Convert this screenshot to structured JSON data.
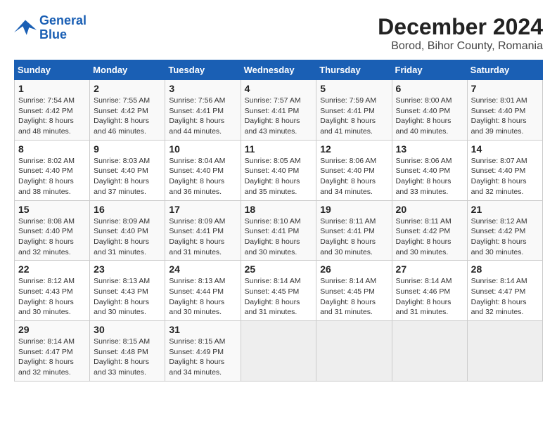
{
  "header": {
    "logo_line1": "General",
    "logo_line2": "Blue",
    "main_title": "December 2024",
    "subtitle": "Borod, Bihor County, Romania"
  },
  "calendar": {
    "days_of_week": [
      "Sunday",
      "Monday",
      "Tuesday",
      "Wednesday",
      "Thursday",
      "Friday",
      "Saturday"
    ],
    "weeks": [
      [
        {
          "day": "",
          "empty": true
        },
        {
          "day": "",
          "empty": true
        },
        {
          "day": "",
          "empty": true
        },
        {
          "day": "",
          "empty": true
        },
        {
          "day": "",
          "empty": true
        },
        {
          "day": "",
          "empty": true
        },
        {
          "day": "",
          "empty": true
        }
      ],
      [
        {
          "day": "1",
          "sunrise": "7:54 AM",
          "sunset": "4:42 PM",
          "daylight": "8 hours and 48 minutes."
        },
        {
          "day": "2",
          "sunrise": "7:55 AM",
          "sunset": "4:42 PM",
          "daylight": "8 hours and 46 minutes."
        },
        {
          "day": "3",
          "sunrise": "7:56 AM",
          "sunset": "4:41 PM",
          "daylight": "8 hours and 44 minutes."
        },
        {
          "day": "4",
          "sunrise": "7:57 AM",
          "sunset": "4:41 PM",
          "daylight": "8 hours and 43 minutes."
        },
        {
          "day": "5",
          "sunrise": "7:59 AM",
          "sunset": "4:41 PM",
          "daylight": "8 hours and 41 minutes."
        },
        {
          "day": "6",
          "sunrise": "8:00 AM",
          "sunset": "4:40 PM",
          "daylight": "8 hours and 40 minutes."
        },
        {
          "day": "7",
          "sunrise": "8:01 AM",
          "sunset": "4:40 PM",
          "daylight": "8 hours and 39 minutes."
        }
      ],
      [
        {
          "day": "8",
          "sunrise": "8:02 AM",
          "sunset": "4:40 PM",
          "daylight": "8 hours and 38 minutes."
        },
        {
          "day": "9",
          "sunrise": "8:03 AM",
          "sunset": "4:40 PM",
          "daylight": "8 hours and 37 minutes."
        },
        {
          "day": "10",
          "sunrise": "8:04 AM",
          "sunset": "4:40 PM",
          "daylight": "8 hours and 36 minutes."
        },
        {
          "day": "11",
          "sunrise": "8:05 AM",
          "sunset": "4:40 PM",
          "daylight": "8 hours and 35 minutes."
        },
        {
          "day": "12",
          "sunrise": "8:06 AM",
          "sunset": "4:40 PM",
          "daylight": "8 hours and 34 minutes."
        },
        {
          "day": "13",
          "sunrise": "8:06 AM",
          "sunset": "4:40 PM",
          "daylight": "8 hours and 33 minutes."
        },
        {
          "day": "14",
          "sunrise": "8:07 AM",
          "sunset": "4:40 PM",
          "daylight": "8 hours and 32 minutes."
        }
      ],
      [
        {
          "day": "15",
          "sunrise": "8:08 AM",
          "sunset": "4:40 PM",
          "daylight": "8 hours and 32 minutes."
        },
        {
          "day": "16",
          "sunrise": "8:09 AM",
          "sunset": "4:40 PM",
          "daylight": "8 hours and 31 minutes."
        },
        {
          "day": "17",
          "sunrise": "8:09 AM",
          "sunset": "4:41 PM",
          "daylight": "8 hours and 31 minutes."
        },
        {
          "day": "18",
          "sunrise": "8:10 AM",
          "sunset": "4:41 PM",
          "daylight": "8 hours and 30 minutes."
        },
        {
          "day": "19",
          "sunrise": "8:11 AM",
          "sunset": "4:41 PM",
          "daylight": "8 hours and 30 minutes."
        },
        {
          "day": "20",
          "sunrise": "8:11 AM",
          "sunset": "4:42 PM",
          "daylight": "8 hours and 30 minutes."
        },
        {
          "day": "21",
          "sunrise": "8:12 AM",
          "sunset": "4:42 PM",
          "daylight": "8 hours and 30 minutes."
        }
      ],
      [
        {
          "day": "22",
          "sunrise": "8:12 AM",
          "sunset": "4:43 PM",
          "daylight": "8 hours and 30 minutes."
        },
        {
          "day": "23",
          "sunrise": "8:13 AM",
          "sunset": "4:43 PM",
          "daylight": "8 hours and 30 minutes."
        },
        {
          "day": "24",
          "sunrise": "8:13 AM",
          "sunset": "4:44 PM",
          "daylight": "8 hours and 30 minutes."
        },
        {
          "day": "25",
          "sunrise": "8:14 AM",
          "sunset": "4:45 PM",
          "daylight": "8 hours and 31 minutes."
        },
        {
          "day": "26",
          "sunrise": "8:14 AM",
          "sunset": "4:45 PM",
          "daylight": "8 hours and 31 minutes."
        },
        {
          "day": "27",
          "sunrise": "8:14 AM",
          "sunset": "4:46 PM",
          "daylight": "8 hours and 31 minutes."
        },
        {
          "day": "28",
          "sunrise": "8:14 AM",
          "sunset": "4:47 PM",
          "daylight": "8 hours and 32 minutes."
        }
      ],
      [
        {
          "day": "29",
          "sunrise": "8:14 AM",
          "sunset": "4:47 PM",
          "daylight": "8 hours and 32 minutes."
        },
        {
          "day": "30",
          "sunrise": "8:15 AM",
          "sunset": "4:48 PM",
          "daylight": "8 hours and 33 minutes."
        },
        {
          "day": "31",
          "sunrise": "8:15 AM",
          "sunset": "4:49 PM",
          "daylight": "8 hours and 34 minutes."
        },
        {
          "day": "",
          "empty": true
        },
        {
          "day": "",
          "empty": true
        },
        {
          "day": "",
          "empty": true
        },
        {
          "day": "",
          "empty": true
        }
      ]
    ]
  }
}
